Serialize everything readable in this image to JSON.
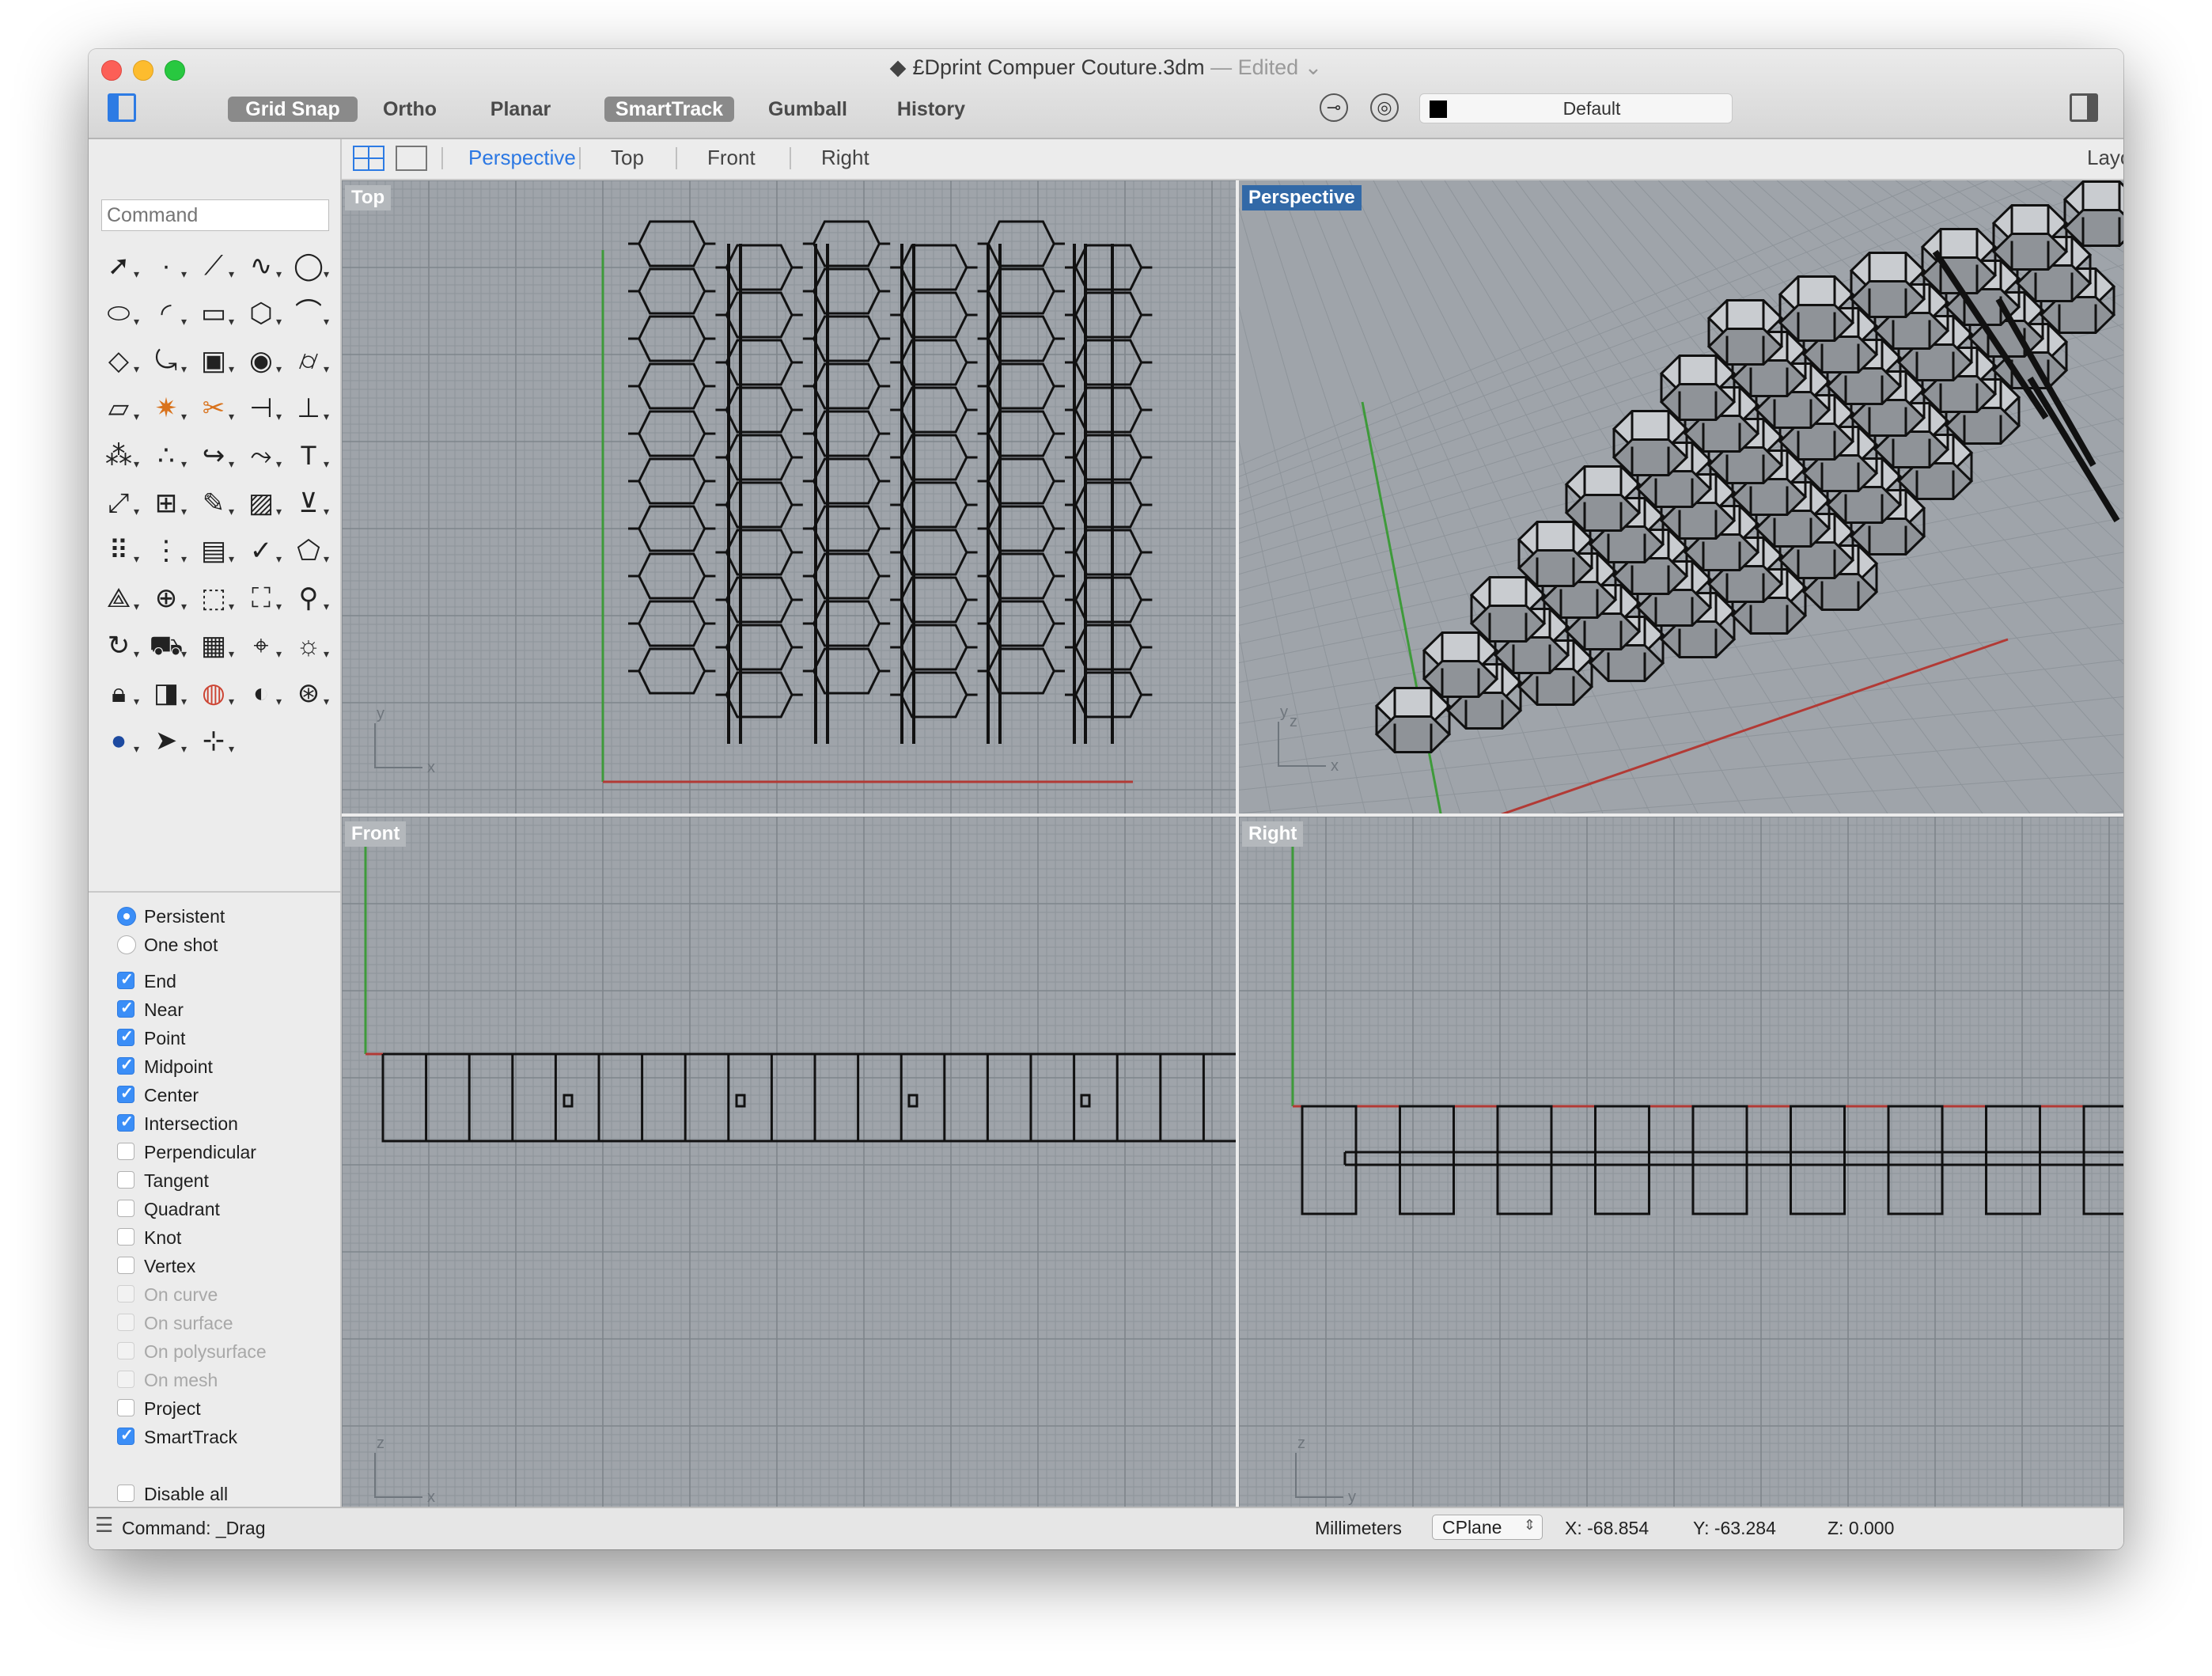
{
  "window": {
    "title": "£Dprint Compuer Couture.3dm",
    "edited_label": "— Edited ⌄"
  },
  "toolbar": {
    "modes": [
      {
        "label": "Grid Snap",
        "on": true
      },
      {
        "label": "Ortho",
        "on": false
      },
      {
        "label": "Planar",
        "on": false
      },
      {
        "label": "SmartTrack",
        "on": true
      },
      {
        "label": "Gumball",
        "on": false
      },
      {
        "label": "History",
        "on": false
      }
    ],
    "layer_name": "Default"
  },
  "command": {
    "placeholder": "Command"
  },
  "viewport_tabs": {
    "tabs": [
      "Perspective",
      "Top",
      "Front",
      "Right"
    ],
    "active": "Perspective",
    "layouts_label": "Layouts..."
  },
  "viewports": {
    "top": "Top",
    "perspective": "Perspective",
    "front": "Front",
    "right": "Right"
  },
  "axis_labels": {
    "top": {
      "a": "y",
      "b": "x"
    },
    "perspective": {
      "a": "y",
      "c": "z",
      "b": "x"
    },
    "front": {
      "a": "z",
      "b": "x"
    },
    "right": {
      "a": "z",
      "b": "y"
    }
  },
  "osnap": {
    "mode": [
      {
        "label": "Persistent",
        "checked": true
      },
      {
        "label": "One shot",
        "checked": false
      }
    ],
    "items": [
      {
        "label": "End",
        "checked": true,
        "enabled": true
      },
      {
        "label": "Near",
        "checked": true,
        "enabled": true
      },
      {
        "label": "Point",
        "checked": true,
        "enabled": true
      },
      {
        "label": "Midpoint",
        "checked": true,
        "enabled": true
      },
      {
        "label": "Center",
        "checked": true,
        "enabled": true
      },
      {
        "label": "Intersection",
        "checked": true,
        "enabled": true
      },
      {
        "label": "Perpendicular",
        "checked": false,
        "enabled": true
      },
      {
        "label": "Tangent",
        "checked": false,
        "enabled": true
      },
      {
        "label": "Quadrant",
        "checked": false,
        "enabled": true
      },
      {
        "label": "Knot",
        "checked": false,
        "enabled": true
      },
      {
        "label": "Vertex",
        "checked": false,
        "enabled": true
      },
      {
        "label": "On curve",
        "checked": false,
        "enabled": false
      },
      {
        "label": "On surface",
        "checked": false,
        "enabled": false
      },
      {
        "label": "On polysurface",
        "checked": false,
        "enabled": false
      },
      {
        "label": "On mesh",
        "checked": false,
        "enabled": false
      },
      {
        "label": "Project",
        "checked": false,
        "enabled": true
      },
      {
        "label": "SmartTrack",
        "checked": true,
        "enabled": true
      }
    ],
    "disable_all": "Disable all"
  },
  "status": {
    "command": "Command: _Drag",
    "units": "Millimeters",
    "cplane": "CPlane",
    "x": "X: -68.854",
    "y": "Y: -63.284",
    "z": "Z: 0.000"
  },
  "colors": {
    "accent": "#2c78e3",
    "viewport_bg": "#9fa4aa",
    "active_viewport_label": "#3269a7",
    "x_axis": "#b23a35",
    "y_axis": "#3e9a3a",
    "geometry": "#111111"
  },
  "tool_icons": [
    "select-arrow-icon",
    "point-icon",
    "polyline-icon",
    "curve-icon",
    "circle-icon",
    "ellipse-icon",
    "arc-icon",
    "rectangle-icon",
    "polygon-icon",
    "fillet-icon",
    "surface-from-points-icon",
    "sweep-icon",
    "box-solid-icon",
    "boolean-icon",
    "cylinder-icon",
    "plane-surface-icon",
    "explode-icon",
    "split-icon",
    "trim-icon",
    "extend-icon",
    "group-icon",
    "ungroup-icon",
    "join-icon",
    "offset-icon",
    "text-icon",
    "move-icon",
    "array-icon",
    "edit-icon",
    "block-icon",
    "dimension-icon",
    "grid-array-icon",
    "properties-icon",
    "layer-icon",
    "check-icon",
    "analyze-icon",
    "render-icon",
    "zoom-in-icon",
    "zoom-window-icon",
    "zoom-extents-icon",
    "zoom-icon",
    "rotate-view-icon",
    "car-icon",
    "grid-icon",
    "snapshot-icon",
    "light-icon",
    "lock-icon",
    "material-icon",
    "color-wheel-icon",
    "sphere-wire-icon",
    "globe-icon",
    "sphere-render-icon",
    "pointer-icon",
    "gumball-icon"
  ]
}
